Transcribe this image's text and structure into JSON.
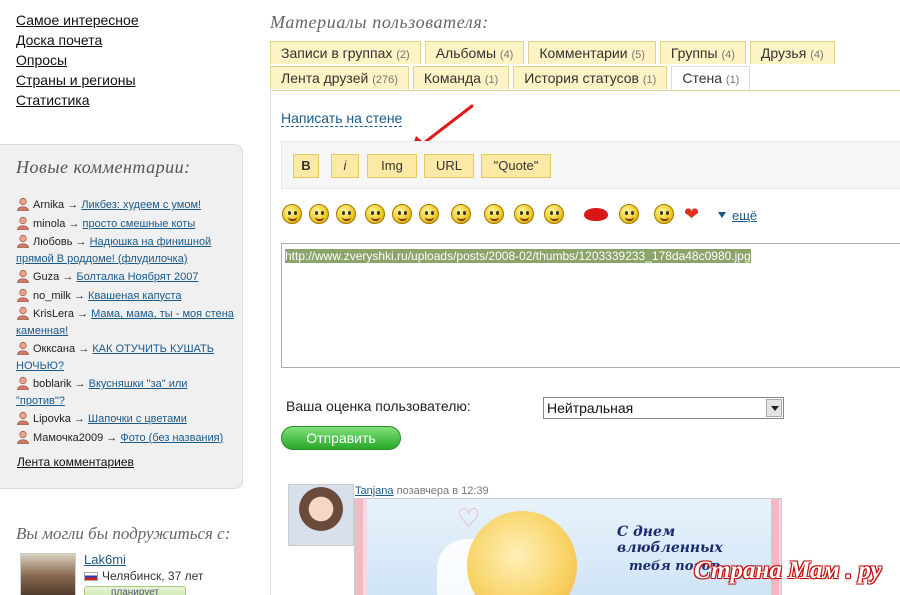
{
  "nav": {
    "items": [
      "Самое интересное",
      "Доска почета",
      "Опросы",
      "Страны и регионы",
      "Статистика"
    ]
  },
  "comments_box": {
    "title": "Новые комментарии:",
    "items": [
      {
        "user": "Arnika",
        "arrow": "→",
        "link": "Ликбез: худеем с умом!"
      },
      {
        "user": "minola",
        "arrow": "→",
        "link": "просто смешные коты"
      },
      {
        "user": "Любовь",
        "arrow": "→",
        "link": "Надюшка на финишной прямой В роддоме! (флудилочка)"
      },
      {
        "user": "Guza",
        "arrow": "→",
        "link": "Болталка Ноябрят 2007"
      },
      {
        "user": "no_milk",
        "arrow": "→",
        "link": "Квашеная капуста"
      },
      {
        "user": "KrisLera",
        "arrow": "→",
        "link": "Мама, мама, ты - моя стена каменная!"
      },
      {
        "user": "Окксана",
        "arrow": "→",
        "link": "КАК ОТУЧИТЬ КУШАТЬ НОЧЬЮ?"
      },
      {
        "user": "boblarik",
        "arrow": "→",
        "link": "Вкусняшки \"за\" или \"против\"?"
      },
      {
        "user": "Lipovka",
        "arrow": "→",
        "link": "Шапочки с цветами"
      },
      {
        "user": "Мамочка2009",
        "arrow": "→",
        "link": "Фото (без названия)"
      }
    ],
    "feed_link": "Лента комментариев"
  },
  "friends": {
    "title": "Вы могли бы подружиться с:",
    "name": "Lak6mi",
    "city": "Челябинск, 37 лет",
    "status": "планирует"
  },
  "materials": {
    "title": "Материалы пользователя:",
    "tabs_row1": [
      {
        "label": "Записи в группах",
        "count": "(2)"
      },
      {
        "label": "Альбомы",
        "count": "(4)"
      },
      {
        "label": "Комментарии",
        "count": "(5)"
      },
      {
        "label": "Группы",
        "count": "(4)"
      },
      {
        "label": "Друзья",
        "count": "(4)"
      }
    ],
    "tabs_row2": [
      {
        "label": "Лента друзей",
        "count": "(276)"
      },
      {
        "label": "Команда",
        "count": "(1)"
      },
      {
        "label": "История статусов",
        "count": "(1)"
      },
      {
        "label": "Стена",
        "count": "(1)"
      }
    ]
  },
  "wall": {
    "write_link": "Написать на стене",
    "toolbar": {
      "bold": "B",
      "italic": "i",
      "img": "Img",
      "url": "URL",
      "quote": "\"Quote\""
    },
    "more_smiles": "ещё",
    "text": "http://www.zveryshki.ru/uploads/posts/2008-02/thumbs/1203339233_178da48c0980.jpg",
    "rating_label": "Ваша оценка пользователю:",
    "rating_value": "Нейтральная",
    "send": "Отправить"
  },
  "post": {
    "author": "Tanjana",
    "time": "позавчера в 12:39",
    "image_text1": "С днем влюбленных",
    "image_text2": "тебя поздр"
  },
  "watermark": "Страна Мам . ру"
}
